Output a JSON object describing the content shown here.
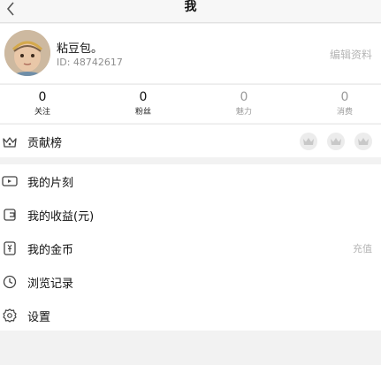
{
  "header": {
    "title": "我"
  },
  "profile": {
    "nickname": "粘豆包。",
    "id_text": "ID: 48742617",
    "edit_label": "编辑资料"
  },
  "stats": [
    {
      "value": "0",
      "label": "关注"
    },
    {
      "value": "0",
      "label": "粉丝"
    },
    {
      "value": "0",
      "label": "魅力"
    },
    {
      "value": "0",
      "label": "消费"
    }
  ],
  "contribution": {
    "label": "贡献榜"
  },
  "menu": [
    {
      "label": "我的片刻",
      "icon": "video-icon"
    },
    {
      "label": "我的收益(元)",
      "icon": "wallet-icon"
    },
    {
      "label": "我的金币",
      "icon": "coin-icon",
      "right": "充值"
    },
    {
      "label": "浏览记录",
      "icon": "clock-icon"
    },
    {
      "label": "设置",
      "icon": "gear-icon"
    }
  ]
}
